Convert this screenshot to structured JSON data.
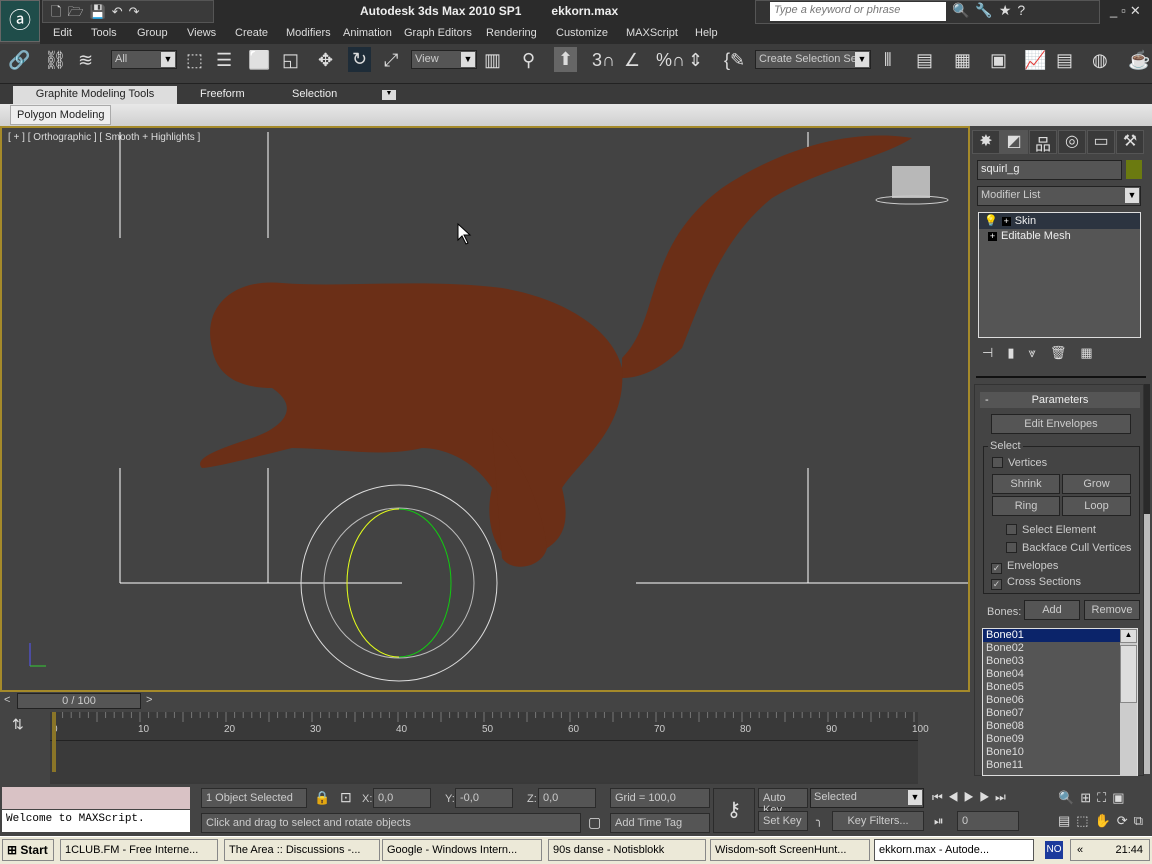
{
  "title": {
    "app": "Autodesk 3ds Max  2010 SP1",
    "file": "ekkorn.max",
    "search_placeholder": "Type a keyword or phrase"
  },
  "menu": [
    "Edit",
    "Tools",
    "Group",
    "Views",
    "Create",
    "Modifiers",
    "Animation",
    "Graph Editors",
    "Rendering",
    "Customize",
    "MAXScript",
    "Help"
  ],
  "toolbar": {
    "selection_filter": "All",
    "ref_coord": "View",
    "named_selection": "Create Selection Se"
  },
  "ribbon": {
    "tabs": [
      "Graphite Modeling Tools",
      "Freeform",
      "Selection"
    ],
    "panel": "Polygon Modeling"
  },
  "viewport": {
    "label": "[ + ] [ Orthographic ] [ Smooth + Highlights ]",
    "model_color": "#6b2f17",
    "border_color": "#a58a2a"
  },
  "command_panel": {
    "object_name": "squirl_g",
    "object_color": "#6b7a10",
    "modifier_list": "Modifier List",
    "stack": [
      {
        "label": "Skin",
        "selected": true
      },
      {
        "label": "Editable Mesh",
        "selected": false
      }
    ],
    "parameters": {
      "title": "Parameters",
      "edit_envelopes": "Edit Envelopes",
      "select_group": "Select",
      "vertices": {
        "label": "Vertices",
        "checked": false
      },
      "shrink": "Shrink",
      "grow": "Grow",
      "ring": "Ring",
      "loop": "Loop",
      "select_element": {
        "label": "Select Element",
        "checked": false
      },
      "backface": {
        "label": "Backface Cull Vertices",
        "checked": false
      },
      "envelopes": {
        "label": "Envelopes",
        "checked": true
      },
      "cross_sections": {
        "label": "Cross Sections",
        "checked": true
      },
      "bones_label": "Bones:",
      "add": "Add",
      "remove": "Remove",
      "bones": [
        "Bone01",
        "Bone02",
        "Bone03",
        "Bone04",
        "Bone05",
        "Bone06",
        "Bone07",
        "Bone08",
        "Bone09",
        "Bone10",
        "Bone11"
      ],
      "selected_bone": "Bone01"
    }
  },
  "timeline": {
    "slider": "0 / 100",
    "ticks": [
      "0",
      "10",
      "20",
      "30",
      "40",
      "50",
      "60",
      "70",
      "80",
      "90",
      "100"
    ]
  },
  "status": {
    "maxscript_output": "Welcome to MAXScript.",
    "selection": "1 Object Selected",
    "x_label": "X:",
    "x": "0,0",
    "y_label": "Y:",
    "y": "-0,0",
    "z_label": "Z:",
    "z": "0,0",
    "grid": "Grid = 100,0",
    "prompt": "Click and drag to select and rotate objects",
    "add_time_tag": "Add Time Tag",
    "auto_key": "Auto Key",
    "set_key": "Set Key",
    "key_mode": "Selected",
    "key_filters": "Key Filters...",
    "frame": "0"
  },
  "taskbar": {
    "start": "Start",
    "tasks": [
      "1CLUB.FM - Free Interne...",
      "The Area :: Discussions -...",
      "Google - Windows Intern...",
      "90s danse - Notisblokk",
      "Wisdom-soft ScreenHunt...",
      "ekkorn.max - Autode..."
    ],
    "lang": "NO",
    "clock": "21:44"
  }
}
